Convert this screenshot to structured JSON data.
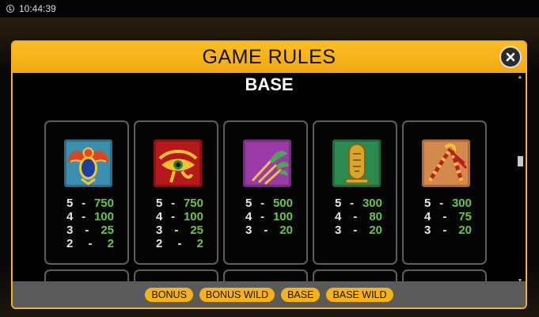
{
  "status_bar": {
    "time": "10:44:39"
  },
  "modal": {
    "title": "GAME RULES",
    "section_title": "BASE"
  },
  "symbols": [
    {
      "name": "scarab",
      "payouts": [
        {
          "count": "5",
          "value": "750"
        },
        {
          "count": "4",
          "value": "100"
        },
        {
          "count": "3",
          "value": "25"
        },
        {
          "count": "2",
          "value": "2"
        }
      ]
    },
    {
      "name": "eye-of-horus",
      "payouts": [
        {
          "count": "5",
          "value": "750"
        },
        {
          "count": "4",
          "value": "100"
        },
        {
          "count": "3",
          "value": "25"
        },
        {
          "count": "2",
          "value": "2"
        }
      ]
    },
    {
      "name": "papyrus",
      "payouts": [
        {
          "count": "5",
          "value": "500"
        },
        {
          "count": "4",
          "value": "100"
        },
        {
          "count": "3",
          "value": "20"
        }
      ]
    },
    {
      "name": "cartouche",
      "payouts": [
        {
          "count": "5",
          "value": "300"
        },
        {
          "count": "4",
          "value": "80"
        },
        {
          "count": "3",
          "value": "20"
        }
      ]
    },
    {
      "name": "crook-and-flail",
      "payouts": [
        {
          "count": "5",
          "value": "300"
        },
        {
          "count": "4",
          "value": "75"
        },
        {
          "count": "3",
          "value": "20"
        }
      ]
    }
  ],
  "tabs": [
    "BONUS",
    "BONUS WILD",
    "BASE",
    "BASE WILD"
  ],
  "colors": {
    "accent": "#f5b21c",
    "payout_value": "#6cc44a",
    "card_border": "#5e5e5e",
    "footer": "#5a5a5a"
  }
}
